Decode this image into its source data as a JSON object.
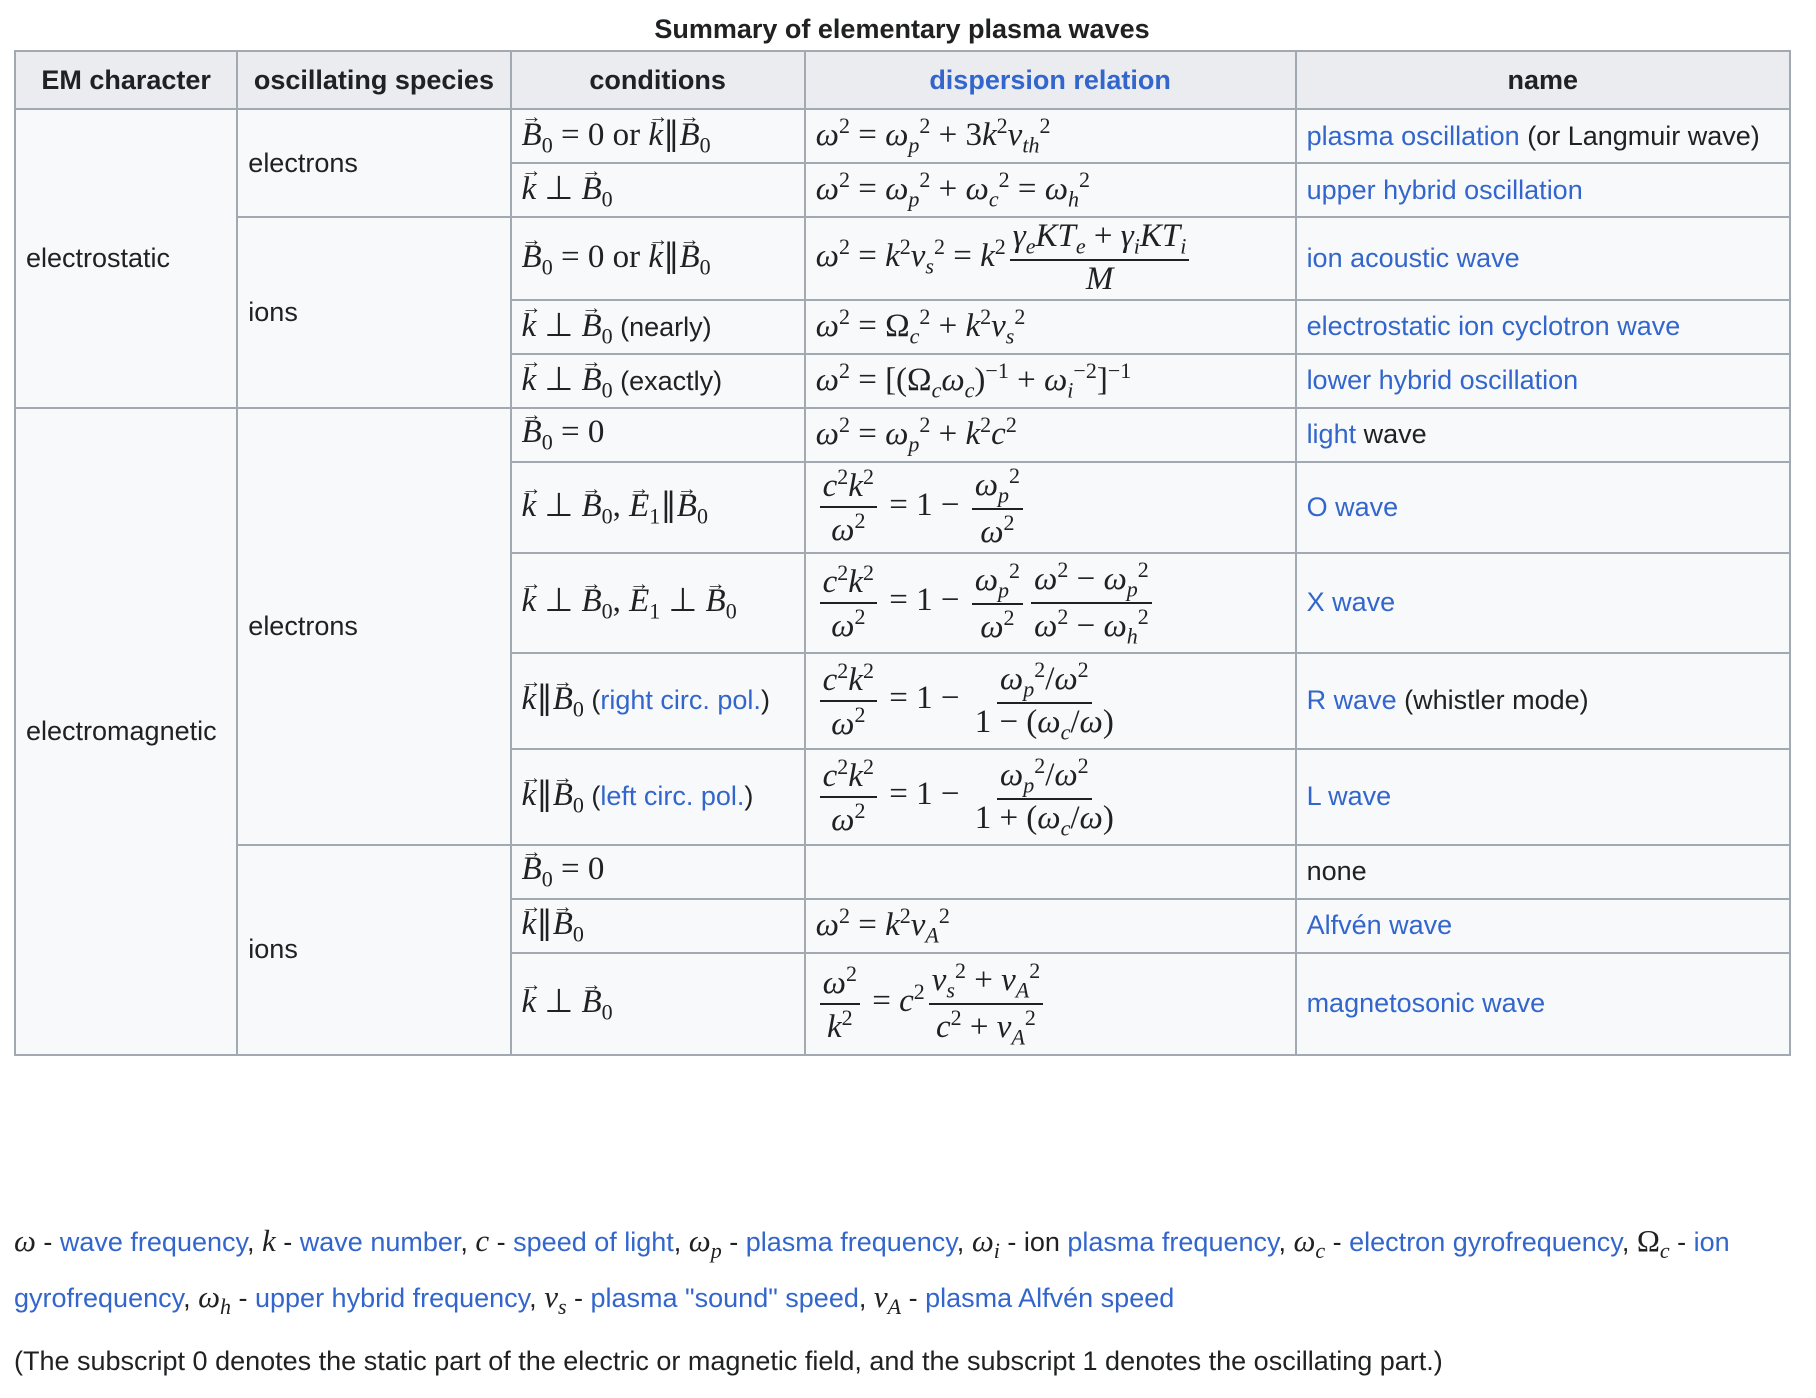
{
  "caption": "Summary of elementary plasma waves",
  "headers": {
    "em_character": "EM character",
    "oscillating_species": "oscillating species",
    "conditions": "conditions",
    "dispersion_relation": "dispersion relation",
    "name": "name"
  },
  "groups": {
    "electrostatic": "electrostatic",
    "electromagnetic": "electromagnetic",
    "electrons": "electrons",
    "ions": "ions"
  },
  "rows": {
    "r1": {
      "cond_or": "or",
      "name_link": "plasma oscillation",
      "name_suffix": "(or Langmuir wave)"
    },
    "r2": {
      "name_link": "upper hybrid oscillation"
    },
    "r3": {
      "cond_or": "or",
      "name_link": "ion acoustic wave"
    },
    "r4": {
      "cond_note": "(nearly)",
      "name_link": "electrostatic ion cyclotron wave"
    },
    "r5": {
      "cond_note": "(exactly)",
      "name_link": "lower hybrid oscillation"
    },
    "r6": {
      "name_link": "light",
      "name_suffix": "wave"
    },
    "r7": {
      "name_link": "O wave"
    },
    "r8": {
      "name_link": "X wave"
    },
    "r9": {
      "cond_link": "right circ. pol.",
      "name_link": "R wave",
      "name_suffix": "(whistler mode)"
    },
    "r10": {
      "cond_link": "left circ. pol.",
      "name_link": "L wave"
    },
    "r11": {
      "name_text": "none"
    },
    "r12": {
      "name_link": "Alfvén wave"
    },
    "r13": {
      "name_link": "magnetosonic wave"
    }
  },
  "legend": {
    "wave_frequency": "wave frequency",
    "wave_number": "wave number",
    "speed_of_light": "speed of light",
    "plasma_frequency": "plasma frequency",
    "ion_word": "ion",
    "ion_plasma_frequency": "plasma frequency",
    "electron_gyrofrequency": "electron gyrofrequency",
    "ion_gyrofrequency_prefix": "ion",
    "ion_gyrofrequency_link": "gyrofrequency",
    "upper_hybrid_frequency": "upper hybrid frequency",
    "plasma_sound_speed": "plasma \"sound\" speed",
    "plasma_alfven_speed": "plasma Alfvén speed"
  },
  "note": "(The subscript 0 denotes the static part of the electric or magnetic field, and the subscript 1 denotes the oscillating part.)"
}
